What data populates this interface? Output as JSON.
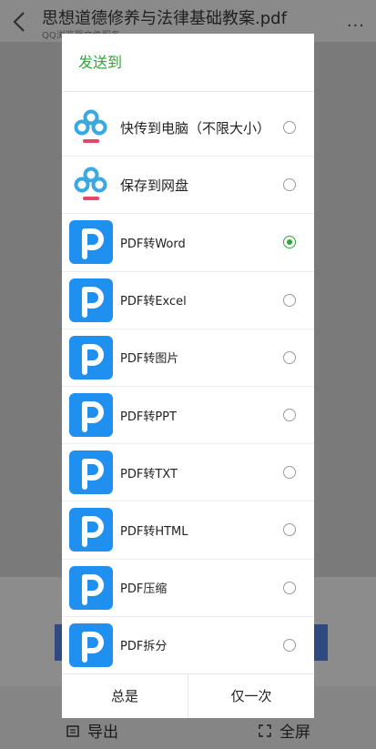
{
  "document": {
    "title": "思想道德修养与法律基础教案.pdf",
    "subtitle": "QQ浏览器文件服务"
  },
  "dialog": {
    "title": "发送到",
    "options": [
      {
        "label": "快传到电脑（不限大小）",
        "icon": "cloud-transfer-icon",
        "selected": false
      },
      {
        "label": "保存到网盘",
        "icon": "cloud-disk-icon",
        "selected": false
      },
      {
        "label": "PDF转Word",
        "icon": "pdf-app-icon",
        "selected": true
      },
      {
        "label": "PDF转Excel",
        "icon": "pdf-app-icon",
        "selected": false
      },
      {
        "label": "PDF转图片",
        "icon": "pdf-app-icon",
        "selected": false
      },
      {
        "label": "PDF转PPT",
        "icon": "pdf-app-icon",
        "selected": false
      },
      {
        "label": "PDF转TXT",
        "icon": "pdf-app-icon",
        "selected": false
      },
      {
        "label": "PDF转HTML",
        "icon": "pdf-app-icon",
        "selected": false
      },
      {
        "label": "PDF压缩",
        "icon": "pdf-app-icon",
        "selected": false
      },
      {
        "label": "PDF拆分",
        "icon": "pdf-app-icon",
        "selected": false
      }
    ],
    "always_label": "总是",
    "once_label": "仅一次"
  },
  "bottom_bar": {
    "export_label": "导出",
    "fullscreen_label": "全屏"
  },
  "colors": {
    "accent_green": "#2fa53c",
    "pdf_blue": "#1f8ff0"
  }
}
